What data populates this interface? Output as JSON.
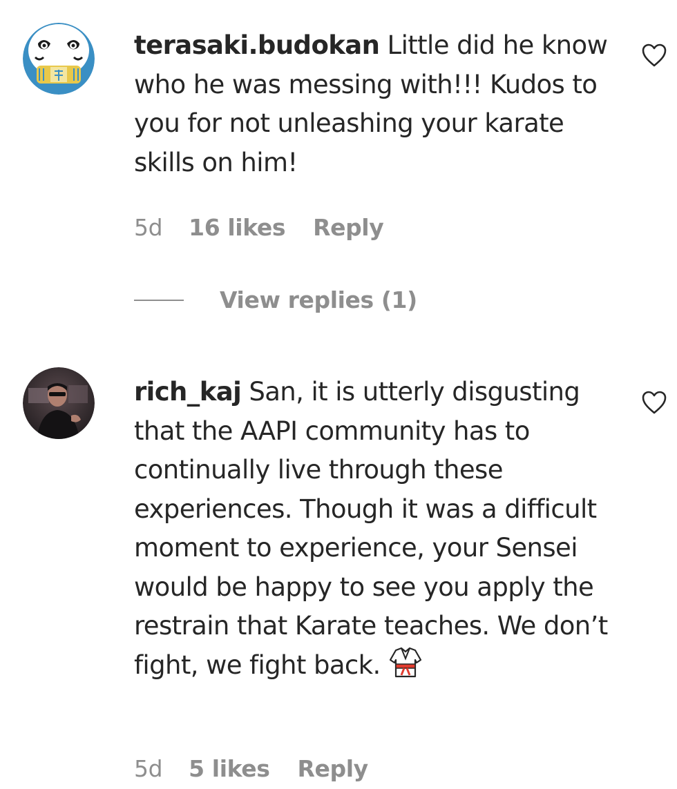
{
  "comments": [
    {
      "username": "terasaki.budokan",
      "text": " Little did he know who he was messing with!!! Kudos to you for not unleashing your karate skills on him!",
      "time": "5d",
      "likes": "16 likes",
      "reply": "Reply",
      "view_replies": "View replies (1)"
    },
    {
      "username": "rich_kaj",
      "text": " San, it is utterly disgusting that the AAPI community has to continually live through these experiences. Though it was a difficult moment to experience, your Sensei would be happy to see you apply the restrain that Karate teaches. We don’t fight, we fight back.",
      "emoji_icon": "martial-arts-uniform-icon",
      "time": "5d",
      "likes": "5 likes",
      "reply": "Reply"
    }
  ],
  "colors": {
    "text": "#262626",
    "secondary": "#8e8e8e",
    "background": "#ffffff"
  }
}
